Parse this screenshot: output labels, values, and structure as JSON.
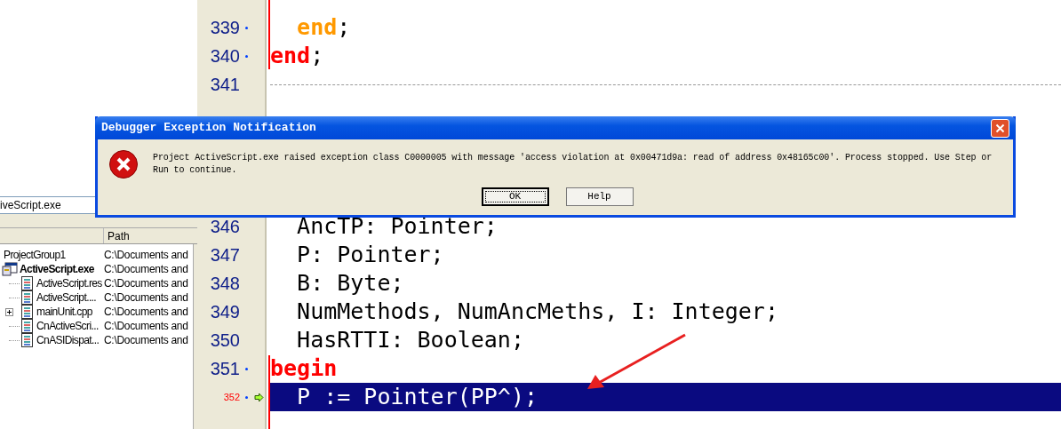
{
  "project_manager": {
    "target_field": {
      "value": "iveScript.exe"
    },
    "path_column": "Path",
    "tree": [
      {
        "name": "ProjectGroup1",
        "kind": "group",
        "path": "C:\\Documents and",
        "children": [
          {
            "name": "ActiveScript.exe",
            "kind": "project",
            "path": "C:\\Documents and",
            "children": [
              {
                "name": "ActiveScript.res",
                "kind": "file",
                "path": "C:\\Documents and"
              },
              {
                "name": "ActiveScript....",
                "kind": "file",
                "path": "C:\\Documents and"
              },
              {
                "name": "mainUnit.cpp",
                "kind": "file",
                "path": "C:\\Documents and",
                "expanded": false
              },
              {
                "name": "CnActiveScri...",
                "kind": "file",
                "path": "C:\\Documents and"
              },
              {
                "name": "CnASIDispat...",
                "kind": "file",
                "path": "C:\\Documents and"
              }
            ]
          }
        ]
      }
    ]
  },
  "editor": {
    "lines": [
      {
        "number": "339",
        "kind": "code",
        "executable": true,
        "current": false,
        "tokens": [
          {
            "text": "  end",
            "kind": "inner_keyword"
          },
          {
            "text": ";",
            "kind": "plain"
          }
        ]
      },
      {
        "number": "340",
        "kind": "code",
        "executable": true,
        "current": false,
        "tokens": [
          {
            "text": "end",
            "kind": "keyword"
          },
          {
            "text": ";",
            "kind": "plain"
          }
        ]
      },
      {
        "number": "341",
        "kind": "separator",
        "executable": false,
        "current": false
      },
      {
        "number": "346",
        "kind": "code",
        "executable": false,
        "current": false,
        "tokens": [
          {
            "text": "  AncTP: Pointer;",
            "kind": "plain"
          }
        ]
      },
      {
        "number": "347",
        "kind": "code",
        "executable": false,
        "current": false,
        "tokens": [
          {
            "text": "  P: Pointer;",
            "kind": "plain"
          }
        ]
      },
      {
        "number": "348",
        "kind": "code",
        "executable": false,
        "current": false,
        "tokens": [
          {
            "text": "  B: Byte;",
            "kind": "plain"
          }
        ]
      },
      {
        "number": "349",
        "kind": "code",
        "executable": false,
        "current": false,
        "tokens": [
          {
            "text": "  NumMethods, NumAncMeths, I: Integer;",
            "kind": "plain"
          }
        ]
      },
      {
        "number": "350",
        "kind": "code",
        "executable": false,
        "current": false,
        "tokens": [
          {
            "text": "  HasRTTI: Boolean;",
            "kind": "plain"
          }
        ]
      },
      {
        "number": "351",
        "kind": "code",
        "executable": true,
        "current": false,
        "tokens": [
          {
            "text": "begin",
            "kind": "keyword"
          }
        ]
      },
      {
        "number": "352",
        "kind": "code",
        "executable": true,
        "current": true,
        "tokens": [
          {
            "text": "  P := Pointer(PP^);",
            "kind": "plain"
          }
        ]
      }
    ]
  },
  "dialog": {
    "title": "Debugger Exception Notification",
    "message": "Project ActiveScript.exe raised exception class C0000005 with message 'access violation at 0x00471d9a: read of address 0x48165c00'. Process stopped. Use Step or Run to continue.",
    "buttons": [
      {
        "label": "OK",
        "default": true
      },
      {
        "label": "Help",
        "default": false
      }
    ]
  }
}
